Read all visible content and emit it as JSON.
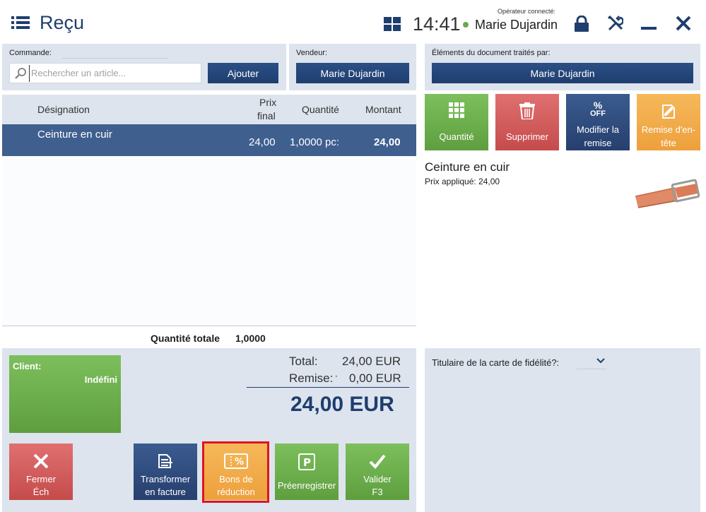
{
  "header": {
    "title": "Reçu",
    "clock": "14:41",
    "operator_label": "Opérateur connecté:",
    "operator_name": "Marie Dujardin"
  },
  "command": {
    "label": "Commande:",
    "search_placeholder": "Rechercher un article...",
    "add_label": "Ajouter"
  },
  "seller": {
    "label": "Vendeur:",
    "name": "Marie Dujardin"
  },
  "processed_by": {
    "label": "Éléments du document traités par:",
    "name": "Marie Dujardin"
  },
  "table": {
    "headers": {
      "designation": "Désignation",
      "price_line1": "Prix",
      "price_line2": "final",
      "quantity": "Quantité",
      "amount": "Montant"
    },
    "rows": [
      {
        "designation": "Ceinture en cuir",
        "price": "24,00",
        "quantity": "1,0000 pc:",
        "amount": "24,00"
      }
    ],
    "total_qty_label": "Quantité totale",
    "total_qty_value": "1,0000"
  },
  "actions": {
    "quantity": "Quantité",
    "delete": "Supprimer",
    "discount_line1": "Modifier la",
    "discount_line2": "remise",
    "discount_icon_top": "%",
    "discount_icon_bottom": "OFF",
    "header_discount_line1": "Remise d'en-",
    "header_discount_line2": "tête"
  },
  "item_detail": {
    "name": "Ceinture en cuir",
    "price_label": "Prix appliqué: 24,00"
  },
  "client": {
    "label": "Client:",
    "value": "Indéfini"
  },
  "totals": {
    "total_label": "Total:",
    "total_value": "24,00 EUR",
    "discount_label": "Remise:",
    "discount_dot": "·",
    "discount_value": "0,00 EUR",
    "grand_total": "24,00 EUR"
  },
  "bottom_buttons": {
    "close_line1": "Fermer",
    "close_line2": "Éch",
    "invoice_line1": "Transformer",
    "invoice_line2": "en facture",
    "vouchers_line1": "Bons de",
    "vouchers_line2": "réduction",
    "preregister": "Préenregistrer",
    "validate_line1": "Valider",
    "validate_line2": "F3"
  },
  "loyalty": {
    "label": "Titulaire de la carte de fidélité?:"
  },
  "colors": {
    "navy": "#1f3e6e",
    "green": "#6aa84f",
    "red": "#c54b4b",
    "orange": "#eda03c",
    "panel": "#dde4ee",
    "highlight": "#e0141e"
  }
}
